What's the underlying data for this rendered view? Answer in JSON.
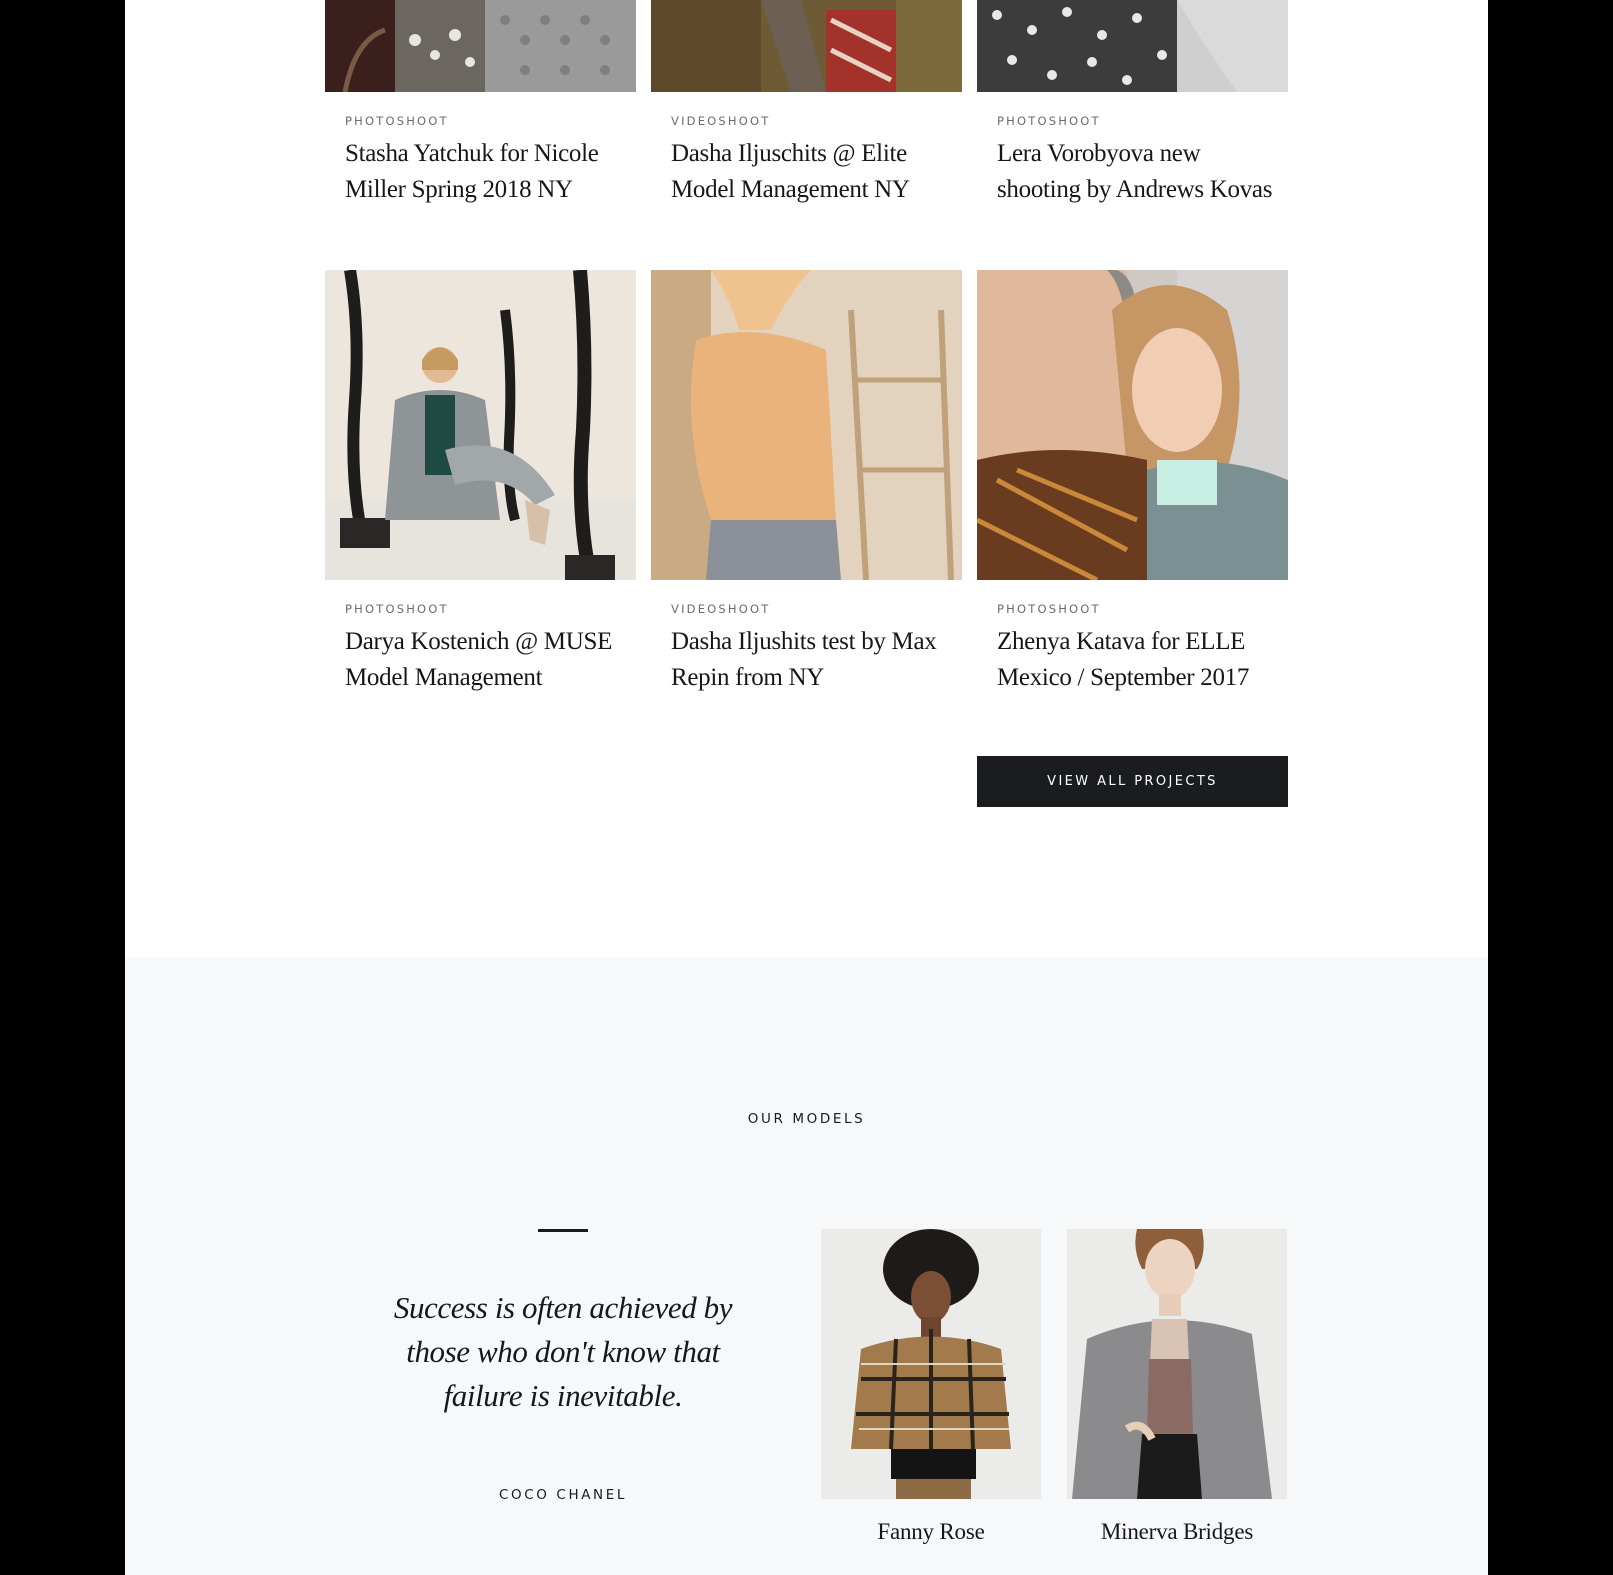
{
  "projects": [
    {
      "category": "PHOTOSHOOT",
      "title": "Stasha Yatchuk for Nicole Miller Spring 2018 NY"
    },
    {
      "category": "VIDEOSHOOT",
      "title": "Dasha Iljuschits @ Elite Model Management NY"
    },
    {
      "category": "PHOTOSHOOT",
      "title": "Lera Vorobyova new shooting by Andrews Kovas"
    },
    {
      "category": "PHOTOSHOOT",
      "title": "Darya Kostenich @ MUSE Model Management"
    },
    {
      "category": "VIDEOSHOOT",
      "title": "Dasha Iljushits test by Max Repin from NY"
    },
    {
      "category": "PHOTOSHOOT",
      "title": "Zhenya Katava for ELLE Mexico / September 2017"
    }
  ],
  "view_all_label": "VIEW ALL PROJECTS",
  "models_section": {
    "label": "OUR MODELS",
    "quote": "Success is often achieved by those who don't know that failure is inevitable.",
    "author": "COCO CHANEL",
    "models": [
      {
        "name": "Fanny Rose"
      },
      {
        "name": "Minerva Bridges"
      }
    ]
  }
}
